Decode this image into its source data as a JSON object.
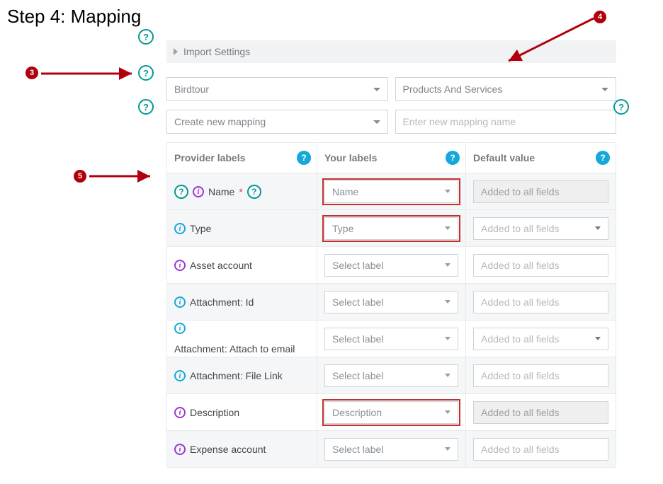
{
  "title": "Step 4: Mapping",
  "import_settings_label": "Import Settings",
  "source_select_value": "Birdtour",
  "target_select_value": "Products And Services",
  "mapping_select_value": "Create new mapping",
  "mapping_name_placeholder": "Enter new mapping name",
  "markers": {
    "m3": "3",
    "m4": "4",
    "m5": "5"
  },
  "table": {
    "headers": {
      "provider": "Provider labels",
      "your": "Your labels",
      "default": "Default value"
    },
    "rows": [
      {
        "info": "purple",
        "label": "Name",
        "required": true,
        "extra_help": true,
        "your_label": "Name",
        "your_hl": true,
        "default_type": "input-disabled",
        "default_value": "Added to all fields",
        "shade": true
      },
      {
        "info": "teal",
        "label": "Type",
        "required": false,
        "extra_help": false,
        "your_label": "Type",
        "your_hl": true,
        "default_type": "select",
        "default_value": "Added to all fields",
        "shade": true
      },
      {
        "info": "purple",
        "label": "Asset account",
        "required": false,
        "extra_help": false,
        "your_label": "Select label",
        "your_hl": false,
        "default_type": "input",
        "default_value": "Added to all fields",
        "shade": false
      },
      {
        "info": "teal",
        "label": "Attachment: Id",
        "required": false,
        "extra_help": false,
        "your_label": "Select label",
        "your_hl": false,
        "default_type": "input",
        "default_value": "Added to all fields",
        "shade": true
      },
      {
        "info": "teal",
        "label": "Attachment: Attach to email",
        "required": false,
        "extra_help": false,
        "your_label": "Select label",
        "your_hl": false,
        "default_type": "select",
        "default_value": "Added to all fields",
        "shade": false
      },
      {
        "info": "teal",
        "label": "Attachment: File Link",
        "required": false,
        "extra_help": false,
        "your_label": "Select label",
        "your_hl": false,
        "default_type": "input",
        "default_value": "Added to all fields",
        "shade": true
      },
      {
        "info": "purple",
        "label": "Description",
        "required": false,
        "extra_help": false,
        "your_label": "Description",
        "your_hl": true,
        "default_type": "input-disabled",
        "default_value": "Added to all fields",
        "shade": false
      },
      {
        "info": "purple",
        "label": "Expense account",
        "required": false,
        "extra_help": false,
        "your_label": "Select label",
        "your_hl": false,
        "default_type": "input",
        "default_value": "Added to all fields",
        "shade": true
      }
    ]
  }
}
